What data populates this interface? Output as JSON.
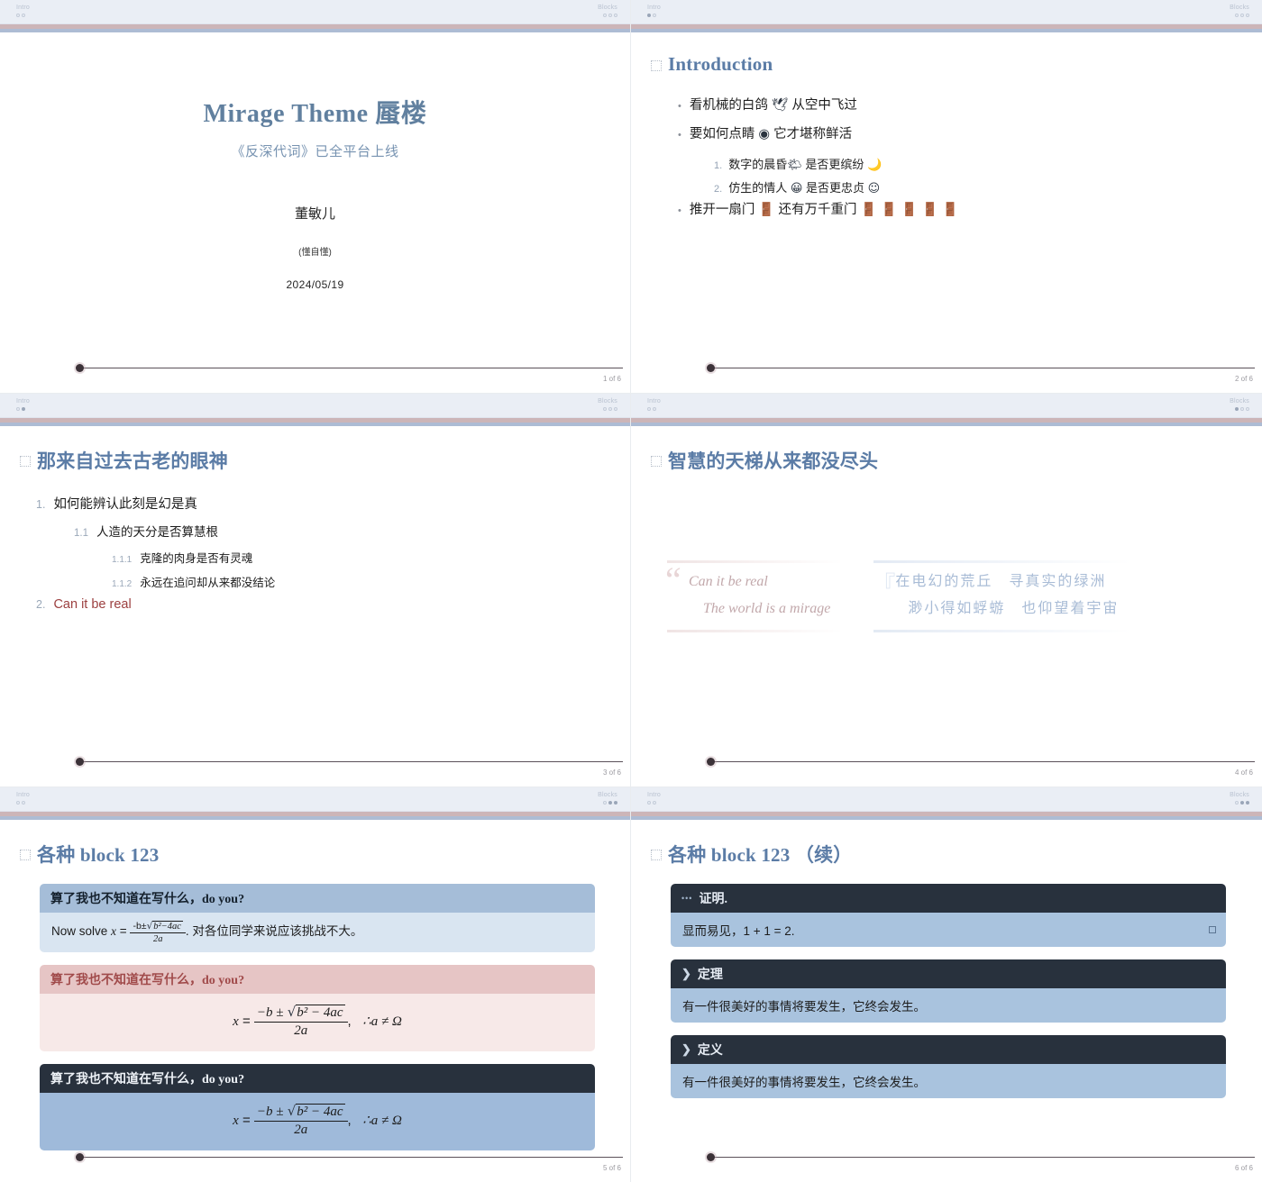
{
  "theme": {
    "accent_blue": "#5b7ca6",
    "accent_rose": "#c2a8ab",
    "dark": "#28313d",
    "body_blue": "#d9e5f1",
    "nav_bg": "#eaeef5"
  },
  "nav": {
    "left_label": "Intro",
    "right_label": "Blocks",
    "left_count": 2,
    "right_count": 3
  },
  "slides": [
    {
      "id": "slide-title",
      "kind": "title",
      "nav_left_active": 0,
      "nav_right_active": -1,
      "page": "1 of 6",
      "title": "Mirage Theme 蜃楼",
      "subtitle": "《反深代词》已全平台上线",
      "author": "董敏儿",
      "affiliation": "(懂自懂)",
      "date": "2024/05/19"
    },
    {
      "id": "slide-introduction",
      "kind": "bullets",
      "nav_left_active": 0,
      "nav_right_active": -1,
      "page": "2 of 6",
      "heading": "Introduction",
      "bullets": [
        {
          "pre": "看机械的白鸽 ",
          "icon": "🕊",
          "post": " 从空中飞过"
        },
        {
          "pre": "要如何点睛 ",
          "icon": "◉",
          "post": " 它才堪称鲜活"
        }
      ],
      "sub_items": [
        {
          "num": "1.",
          "pre": "数字的晨昏",
          "icon": "🌤",
          "post": " 是否更缤纷 ",
          "icon2": "🌙"
        },
        {
          "num": "2.",
          "pre": "仿生的情人 ",
          "icon": "😀",
          "post": " 是否更忠贞 ",
          "icon2": "☺"
        }
      ],
      "last_bullet": {
        "pre": "推开一扇门 ",
        "icon": "🚪",
        "post": " 还有万千重门 ",
        "doors": "🚪 🚪 🚪 🚪 🚪"
      }
    },
    {
      "id": "slide-outline",
      "kind": "outline",
      "nav_left_active": 1,
      "nav_right_active": -1,
      "page": "3 of 6",
      "heading": "那来自过去古老的眼神",
      "rows": [
        {
          "level": 1,
          "num": "1.",
          "text": "如何能辨认此刻是幻是真",
          "alert": false
        },
        {
          "level": 2,
          "num": "1.1",
          "text": "人造的天分是否算慧根",
          "alert": false
        },
        {
          "level": 3,
          "num": "1.1.1",
          "text": "克隆的肉身是否有灵魂",
          "alert": false
        },
        {
          "level": 3,
          "num": "1.1.2",
          "text": "永远在追问却从来都没结论",
          "alert": false
        },
        {
          "level": 1,
          "num": "2.",
          "text": "Can it be real",
          "alert": true
        }
      ]
    },
    {
      "id": "slide-quotes",
      "kind": "quotes",
      "nav_left_active": -1,
      "nav_right_active": 0,
      "page": "4 of 6",
      "heading": "智慧的天梯从来都没尽头",
      "quote_left": {
        "mark": "“",
        "line1": "Can it be real",
        "line2": "The world is a mirage"
      },
      "quote_right": {
        "mark": "『",
        "line1": "在电幻的荒丘　寻真实的绿洲",
        "line2": "渺小得如蜉蝣　也仰望着宇宙"
      }
    },
    {
      "id": "slide-blocks-1",
      "kind": "blocks",
      "nav_left_active": -1,
      "nav_right_active": 1,
      "page": "5 of 6",
      "heading": "各种 block 123",
      "blocks": [
        {
          "style": "std",
          "header": "算了我也不知道在写什么，do you?",
          "body_kind": "inline-math",
          "body_pre": "Now solve ",
          "body_post": ". 对各位同学来说应该挑战不大。"
        },
        {
          "style": "alert",
          "header": "算了我也不知道在写什么，do you?",
          "body_kind": "display-math"
        },
        {
          "style": "dark",
          "header": "算了我也不知道在写什么，do you?",
          "body_kind": "display-math"
        }
      ],
      "math": {
        "var": "x",
        "eq": "=",
        "numerator_a": "−b ±",
        "radicand": "b² − 4ac",
        "denominator": "2a",
        "comma": ",",
        "therefore": "∴a ≠ Ω",
        "inline_num": "-b±",
        "inline_rad": "b²−4ac",
        "inline_den": "2a"
      }
    },
    {
      "id": "slide-blocks-2",
      "kind": "theorems",
      "nav_left_active": -1,
      "nav_right_active": 2,
      "page": "6 of 6",
      "heading": "各种 block 123 （续）",
      "blocks": [
        {
          "icon": "dots-icon",
          "icon_glyph": "•••",
          "header": "证明.",
          "body": "显而易见，1 + 1 = 2.",
          "qed": true
        },
        {
          "icon": "chevron-right-icon",
          "icon_glyph": "❯",
          "header": "定理",
          "body": "有一件很美好的事情将要发生，它终会发生。",
          "qed": false
        },
        {
          "icon": "chevron-right-icon",
          "icon_glyph": "❯",
          "header": "定义",
          "body": "有一件很美好的事情将要发生，它终会发生。",
          "qed": false
        }
      ]
    }
  ]
}
